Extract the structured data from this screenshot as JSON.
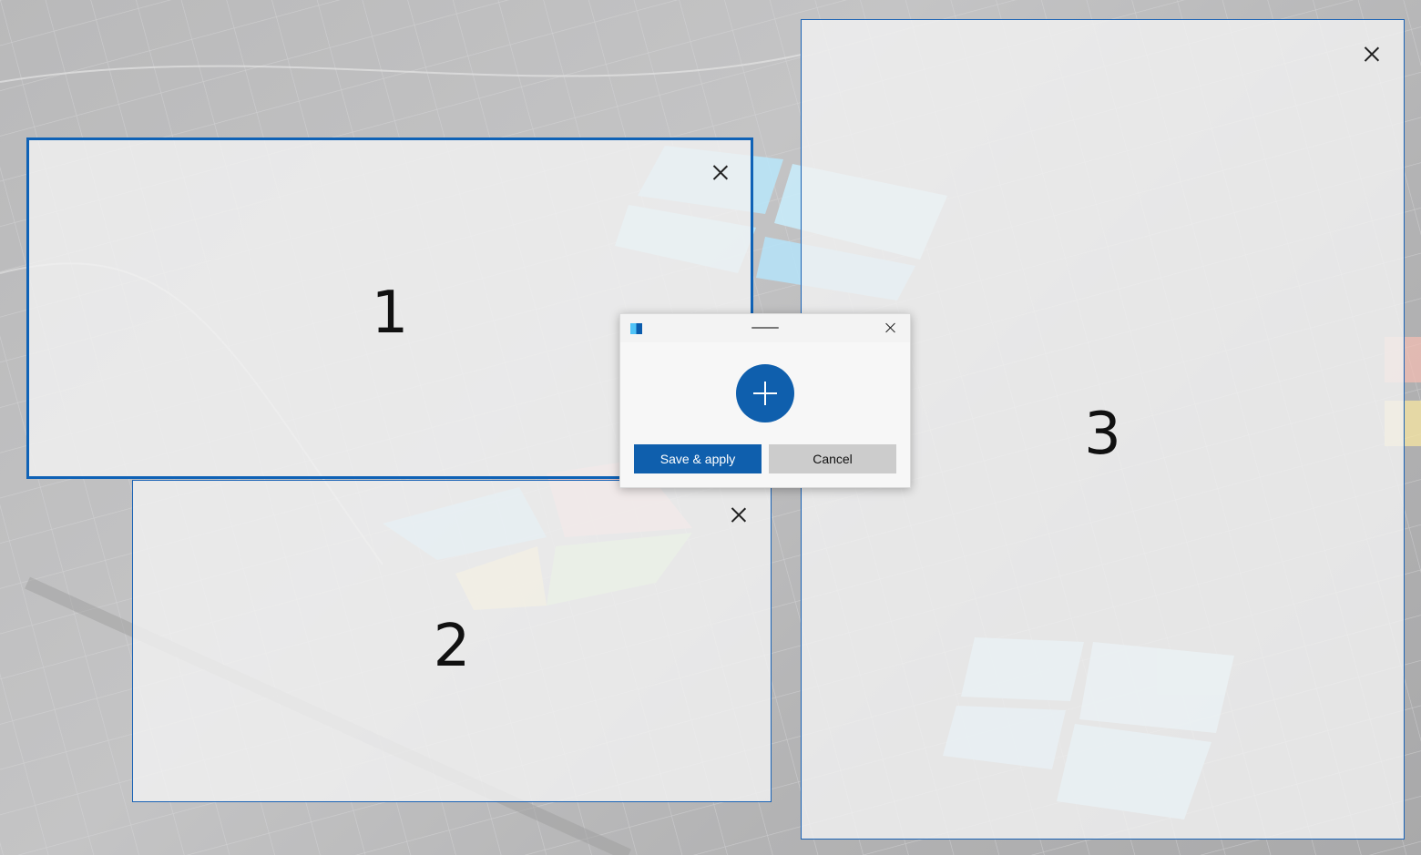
{
  "zones": [
    {
      "number": "1",
      "active": true
    },
    {
      "number": "2",
      "active": false
    },
    {
      "number": "3",
      "active": false
    }
  ],
  "editor": {
    "save_label": "Save & apply",
    "cancel_label": "Cancel"
  },
  "colors": {
    "accent": "#0f5fad",
    "zone_border": "#1b63b5",
    "cancel_bg": "#cccccc"
  },
  "icons": {
    "zone_close": "close-icon",
    "app": "fancyzones-app-icon",
    "add": "add-icon"
  }
}
